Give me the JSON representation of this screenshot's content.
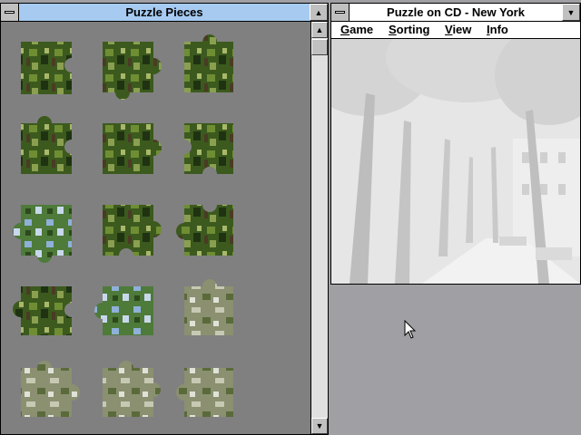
{
  "pieces_window": {
    "title": "Puzzle Pieces",
    "system_icon": "system-menu-icon",
    "maximize_icon": "maximize-arrow-icon",
    "scroll_up_icon": "scroll-up-arrow-icon",
    "scroll_down_icon": "scroll-down-arrow-icon",
    "pieces_count": 15
  },
  "puzzle_window": {
    "title": "Puzzle on CD - New York",
    "system_icon": "system-menu-icon",
    "maximize_icon": "maximize-arrow-icon",
    "menu": [
      {
        "first": "G",
        "rest": "ame"
      },
      {
        "first": "S",
        "rest": "orting"
      },
      {
        "first": "V",
        "rest": "iew"
      },
      {
        "first": "I",
        "rest": "nfo"
      }
    ]
  },
  "colors": {
    "active_title": "#a6caf0",
    "desktop": "#a0a0a4",
    "piece_area": "#808080",
    "scrollbar_track": "#e0e0e0",
    "preview_bg": "#e4e4e4"
  },
  "cursor_icon": "arrow-cursor-icon"
}
